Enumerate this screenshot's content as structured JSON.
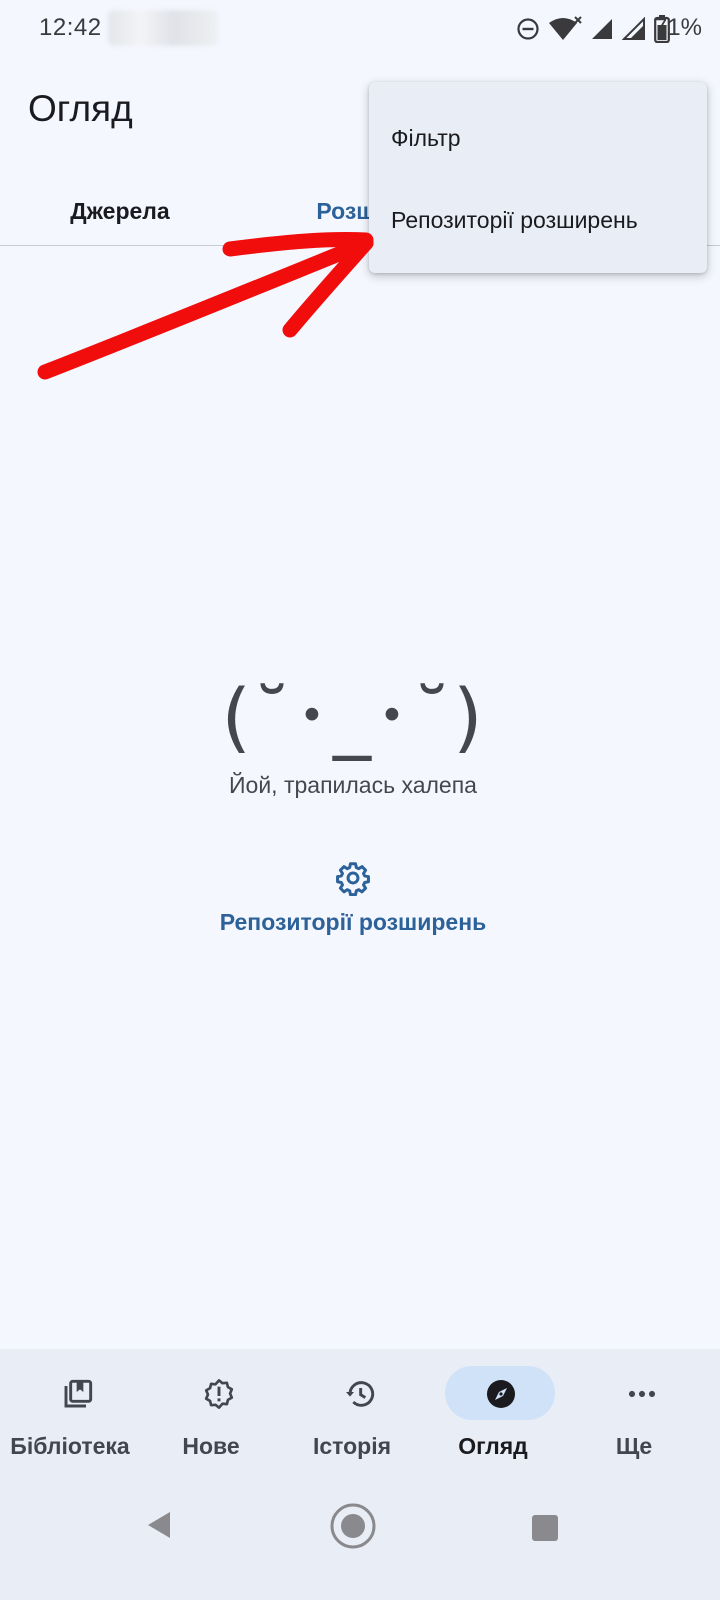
{
  "status_bar": {
    "time": "12:42",
    "battery": "71%",
    "icons": [
      "dnd-icon",
      "wifi-icon",
      "signal-icon",
      "signal-icon-2",
      "battery-icon"
    ]
  },
  "header": {
    "title": "Огляд"
  },
  "tabs": [
    {
      "label": "Джерела",
      "selected": false
    },
    {
      "label": "Розшир",
      "selected": true
    }
  ],
  "overflow_menu": {
    "items": [
      {
        "label": "Фільтр"
      },
      {
        "label": "Репозиторії розширень"
      }
    ]
  },
  "empty_state": {
    "kaomoji": "(˘･_･˘)",
    "message": "Йой, трапилась халепа",
    "action_icon": "gear-icon",
    "action_label": "Репозиторії розширень"
  },
  "bottom_nav": [
    {
      "label": "Бібліотека",
      "icon": "library-icon",
      "active": false
    },
    {
      "label": "Нове",
      "icon": "new-badge-icon",
      "active": false
    },
    {
      "label": "Історія",
      "icon": "history-icon",
      "active": false
    },
    {
      "label": "Огляд",
      "icon": "compass-icon",
      "active": true
    },
    {
      "label": "Ще",
      "icon": "more-icon",
      "active": false
    }
  ],
  "colors": {
    "background": "#f4f8fe",
    "accent": "#2d6199",
    "menu_bg": "#e8edf6",
    "nav_bg": "#e9edf5",
    "active_pill": "#cfe2f8",
    "annotation": "#f20d0d"
  }
}
